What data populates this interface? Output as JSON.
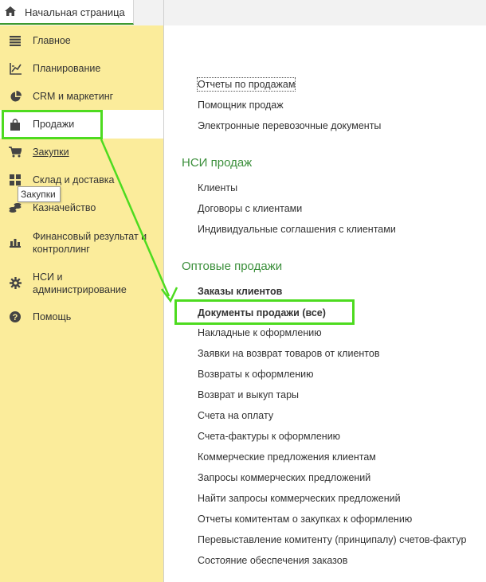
{
  "top_tab": {
    "label": "Начальная страница"
  },
  "sidebar": {
    "items": [
      {
        "label": "Главное",
        "icon": "menu-lines-icon"
      },
      {
        "label": "Планирование",
        "icon": "planning-chart-icon"
      },
      {
        "label": "CRM и маркетинг",
        "icon": "pie-chart-icon"
      },
      {
        "label": "Продажи",
        "icon": "shopping-bag-icon"
      },
      {
        "label": "Закупки",
        "icon": "cart-icon"
      },
      {
        "label": "Склад и доставка",
        "icon": "grid-blocks-icon"
      },
      {
        "label": "Казначейство",
        "icon": "coins-icon"
      },
      {
        "label": "Финансовый результат и",
        "label2": "контроллинг",
        "icon": "bar-chart-icon"
      },
      {
        "label": "НСИ и",
        "label2": "администрирование",
        "icon": "gear-icon"
      },
      {
        "label": "Помощь",
        "icon": "help-icon"
      }
    ],
    "tooltip": "Закупки"
  },
  "main": {
    "top_links": [
      "Отчеты по продажам",
      "Помощник продаж",
      "Электронные перевозочные документы"
    ],
    "nsi": {
      "title": "НСИ продаж",
      "links": [
        "Клиенты",
        "Договоры с клиентами",
        "Индивидуальные соглашения с клиентами"
      ]
    },
    "wholesale": {
      "title": "Оптовые продажи",
      "links": [
        "Заказы клиентов",
        "Документы продажи (все)",
        "Накладные к оформлению",
        "Заявки на возврат товаров от клиентов",
        "Возвраты к оформлению",
        "Возврат и выкуп тары",
        "Счета на оплату",
        "Счета-фактуры к оформлению",
        "Коммерческие предложения клиентам",
        "Запросы коммерческих предложений",
        "Найти запросы коммерческих предложений",
        "Отчеты комитентам о закупках к оформлению",
        "Перевыставление комитенту (принципалу) счетов-фактур",
        "Состояние обеспечения заказов"
      ]
    }
  },
  "colors": {
    "sidebar_bg": "#fbec9b",
    "section_title": "#3b8f3b",
    "highlight": "#4ddb1f",
    "tab_underline": "#3d9a2f"
  }
}
